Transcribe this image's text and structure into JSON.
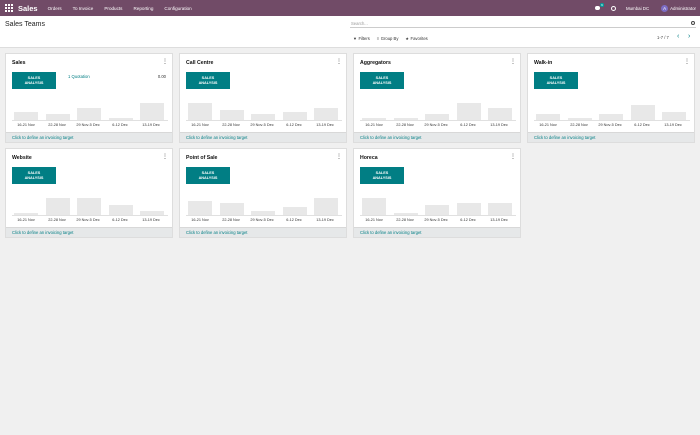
{
  "navbar": {
    "brand": "Sales",
    "menu": [
      "Orders",
      "To Invoice",
      "Products",
      "Reporting",
      "Configuration"
    ],
    "chat_badge": "9",
    "company": "Mumbai DC",
    "user_initial": "A",
    "user_name": "Administrator",
    "color": "#714b67"
  },
  "control": {
    "title": "Sales Teams",
    "search_placeholder": "Search...",
    "filters_label": "Filters",
    "groupby_label": "Group By",
    "favorites_label": "Favorites",
    "pager": "1-7 / 7"
  },
  "accent_color": "#017e84",
  "button_label": "SALES ANALYSIS",
  "footer_label": "Click to define an invoicing target",
  "week_labels": [
    "16-21 Nov",
    "22-28 Nov",
    "29 Nov-5 Dec",
    "6-12 Dec",
    "13-19 Dec"
  ],
  "teams": [
    {
      "name": "Sales",
      "quotation": "1 Quotation",
      "amount": "0.00",
      "bars": [
        0.28,
        0.2,
        0.42,
        0.07,
        0.6
      ]
    },
    {
      "name": "Call Centre",
      "quotation": "",
      "amount": "",
      "bars": [
        0.6,
        0.35,
        0.2,
        0.28,
        0.42
      ]
    },
    {
      "name": "Aggregators",
      "quotation": "",
      "amount": "",
      "bars": [
        0.07,
        0.07,
        0.2,
        0.6,
        0.42
      ]
    },
    {
      "name": "Walk-in",
      "quotation": "",
      "amount": "",
      "bars": [
        0.2,
        0.07,
        0.2,
        0.55,
        0.28
      ]
    },
    {
      "name": "Website",
      "quotation": "",
      "amount": "",
      "bars": [
        0.07,
        0.6,
        0.6,
        0.35,
        0.14
      ]
    },
    {
      "name": "Point of Sale",
      "quotation": "",
      "amount": "",
      "bars": [
        0.5,
        0.42,
        0.14,
        0.3,
        0.6
      ]
    },
    {
      "name": "Horeca",
      "quotation": "",
      "amount": "",
      "bars": [
        0.6,
        0.07,
        0.35,
        0.42,
        0.42
      ]
    }
  ]
}
